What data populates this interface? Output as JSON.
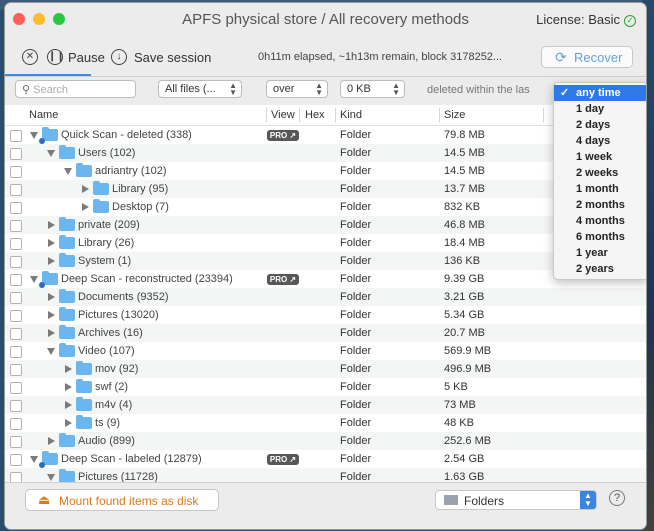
{
  "window": {
    "title": "APFS physical store / All recovery methods",
    "license_label": "License: Basic"
  },
  "toolbar": {
    "pause_label": "Pause",
    "save_label": "Save session",
    "status_text": "0h11m elapsed, ~1h13m remain, block 3178252...",
    "recover_label": "Recover"
  },
  "filter": {
    "search_placeholder": "Search",
    "type_value": "All files (...",
    "size_op_value": "over",
    "size_value": "0 KB",
    "date_label": "deleted within the las"
  },
  "columns": {
    "name": "Name",
    "view": "View",
    "hex": "Hex",
    "kind": "Kind",
    "size": "Size"
  },
  "rows": [
    {
      "name": "Quick Scan - deleted (338)",
      "kind": "Folder",
      "size": "79.8 MB",
      "level": 0,
      "expanded": true,
      "pro": true,
      "scan": true
    },
    {
      "name": "Users (102)",
      "kind": "Folder",
      "size": "14.5 MB",
      "level": 1,
      "expanded": true,
      "pro": false,
      "scan": false
    },
    {
      "name": "adriantry (102)",
      "kind": "Folder",
      "size": "14.5 MB",
      "level": 2,
      "expanded": true,
      "pro": false,
      "scan": false
    },
    {
      "name": "Library (95)",
      "kind": "Folder",
      "size": "13.7 MB",
      "level": 3,
      "expanded": false,
      "pro": false,
      "scan": false
    },
    {
      "name": "Desktop (7)",
      "kind": "Folder",
      "size": "832 KB",
      "level": 3,
      "expanded": false,
      "pro": false,
      "scan": false
    },
    {
      "name": "private (209)",
      "kind": "Folder",
      "size": "46.8 MB",
      "level": 1,
      "expanded": false,
      "pro": false,
      "scan": false
    },
    {
      "name": "Library (26)",
      "kind": "Folder",
      "size": "18.4 MB",
      "level": 1,
      "expanded": false,
      "pro": false,
      "scan": false
    },
    {
      "name": "System (1)",
      "kind": "Folder",
      "size": "136 KB",
      "level": 1,
      "expanded": false,
      "pro": false,
      "scan": false
    },
    {
      "name": "Deep Scan - reconstructed (23394)",
      "kind": "Folder",
      "size": "9.39 GB",
      "level": 0,
      "expanded": true,
      "pro": true,
      "scan": true
    },
    {
      "name": "Documents (9352)",
      "kind": "Folder",
      "size": "3.21 GB",
      "level": 1,
      "expanded": false,
      "pro": false,
      "scan": false
    },
    {
      "name": "Pictures (13020)",
      "kind": "Folder",
      "size": "5.34 GB",
      "level": 1,
      "expanded": false,
      "pro": false,
      "scan": false
    },
    {
      "name": "Archives (16)",
      "kind": "Folder",
      "size": "20.7 MB",
      "level": 1,
      "expanded": false,
      "pro": false,
      "scan": false
    },
    {
      "name": "Video (107)",
      "kind": "Folder",
      "size": "569.9 MB",
      "level": 1,
      "expanded": true,
      "pro": false,
      "scan": false
    },
    {
      "name": "mov (92)",
      "kind": "Folder",
      "size": "496.9 MB",
      "level": 2,
      "expanded": false,
      "pro": false,
      "scan": false
    },
    {
      "name": "swf (2)",
      "kind": "Folder",
      "size": "5 KB",
      "level": 2,
      "expanded": false,
      "pro": false,
      "scan": false
    },
    {
      "name": "m4v (4)",
      "kind": "Folder",
      "size": "73 MB",
      "level": 2,
      "expanded": false,
      "pro": false,
      "scan": false
    },
    {
      "name": "ts (9)",
      "kind": "Folder",
      "size": "48 KB",
      "level": 2,
      "expanded": false,
      "pro": false,
      "scan": false
    },
    {
      "name": "Audio (899)",
      "kind": "Folder",
      "size": "252.6 MB",
      "level": 1,
      "expanded": false,
      "pro": false,
      "scan": false
    },
    {
      "name": "Deep Scan - labeled (12879)",
      "kind": "Folder",
      "size": "2.54 GB",
      "level": 0,
      "expanded": true,
      "pro": true,
      "scan": true
    },
    {
      "name": "Pictures (11728)",
      "kind": "Folder",
      "size": "1.63 GB",
      "level": 1,
      "expanded": true,
      "pro": false,
      "scan": false
    }
  ],
  "pro_badge": "PRO ↗",
  "date_options": [
    "any time",
    "1 day",
    "2 days",
    "4 days",
    "1 week",
    "2 weeks",
    "1 month",
    "2 months",
    "4 months",
    "6 months",
    "1 year",
    "2 years"
  ],
  "date_selected": "any time",
  "footer": {
    "mount_label": "Mount found items as disk",
    "view_mode_value": "Folders",
    "help_label": "?"
  },
  "colors": {
    "accent": "#2f78e8",
    "folder": "#6cb6f0",
    "mount_orange": "#d87a1a",
    "recover_text": "#6aa3d8"
  },
  "icons": {
    "stop": "stop-circle-icon",
    "pause": "pause-circle-icon",
    "save": "download-circle-icon",
    "recover": "refresh-icon",
    "mount": "disk-mount-icon",
    "search": "search-icon"
  }
}
